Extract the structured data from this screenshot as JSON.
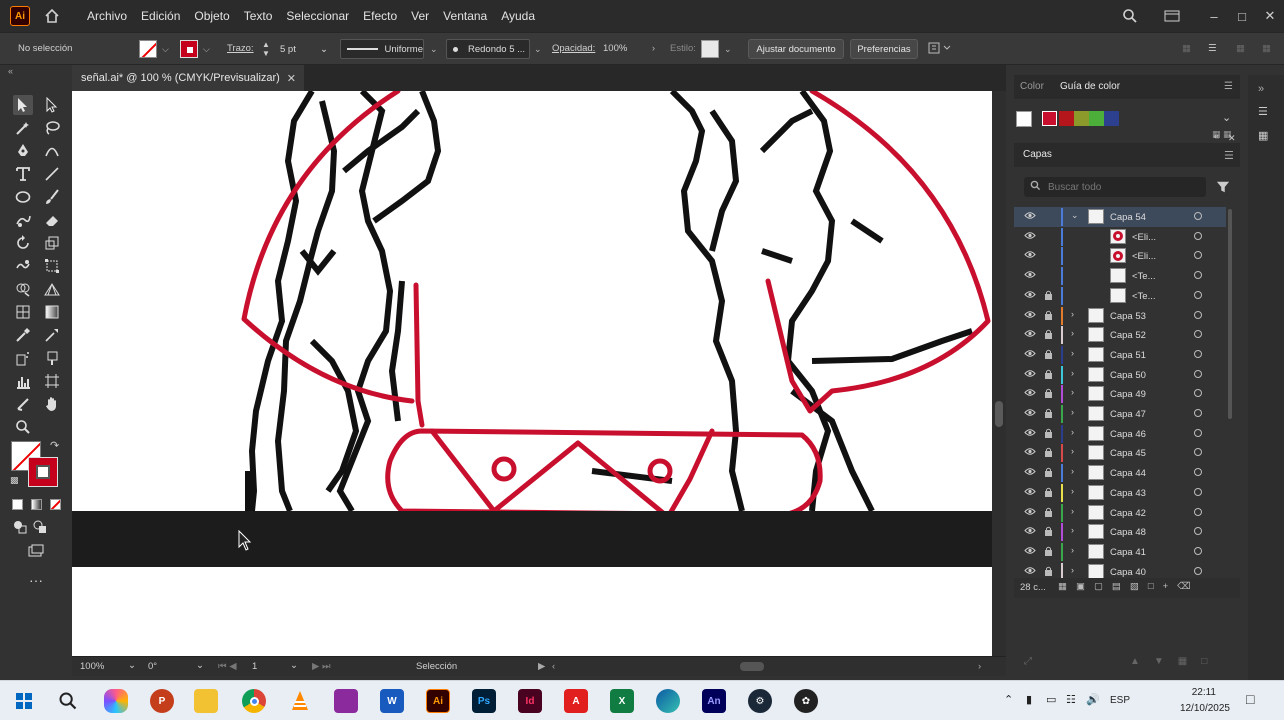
{
  "app": {
    "logo_text": "Ai",
    "menus": [
      "Archivo",
      "Edición",
      "Objeto",
      "Texto",
      "Seleccionar",
      "Efecto",
      "Ver",
      "Ventana",
      "Ayuda"
    ]
  },
  "control_bar": {
    "selection_label": "No selección",
    "stroke_label": "Trazo:",
    "stroke_value": "5 pt",
    "profile_value": "Uniforme",
    "brush_value": "Redondo 5 ...",
    "opacity_label": "Opacidad:",
    "opacity_value": "100%",
    "style_label": "Estilo:",
    "adjust_button": "Ajustar documento",
    "prefs_button": "Preferencias"
  },
  "document": {
    "tab_title": "señal.ai* @ 100 % (CMYK/Previsualizar)"
  },
  "status_bar": {
    "zoom": "100%",
    "rotation": "0°",
    "artboard": "1",
    "tool": "Selección"
  },
  "panels": {
    "tab_color": "Color",
    "tab_guide": "Guía de color",
    "layers_title": "Capas",
    "search_placeholder": "Buscar todo",
    "layers_count": "28 c...",
    "guide_colors": [
      "#ffffff",
      "#c8102e",
      "#b4161b",
      "#8c9a2b",
      "#4caf3a",
      "#2d3f8f"
    ]
  },
  "layers": [
    {
      "name": "Capa 54",
      "color": "#4a7bd8",
      "expanded": true,
      "selected": true,
      "lock": false
    },
    {
      "name": "<Eli...",
      "color": "#4a7bd8",
      "sub": true,
      "thumb": "circle-red"
    },
    {
      "name": "<Eli...",
      "color": "#4a7bd8",
      "sub": true,
      "thumb": "circle-red"
    },
    {
      "name": "<Te...",
      "color": "#4a7bd8",
      "sub": true,
      "thumb": "blank"
    },
    {
      "name": "<Te...",
      "color": "#4a7bd8",
      "sub": true,
      "thumb": "blank",
      "lock": true
    },
    {
      "name": "Capa 53",
      "color": "#e27b2b",
      "lock": true
    },
    {
      "name": "Capa 52",
      "color": "#d8ccd0",
      "lock": true
    },
    {
      "name": "Capa 51",
      "color": "#2a3d8f",
      "lock": true
    },
    {
      "name": "Capa 50",
      "color": "#3cc8d8",
      "lock": true
    },
    {
      "name": "Capa 49",
      "color": "#b24bd8",
      "lock": true
    },
    {
      "name": "Capa 47",
      "color": "#3aa84a",
      "lock": true
    },
    {
      "name": "Capa 46",
      "color": "#2a3d8f",
      "lock": true
    },
    {
      "name": "Capa 45",
      "color": "#d84a4a",
      "lock": true
    },
    {
      "name": "Capa 44",
      "color": "#4a7bd8",
      "lock": true
    },
    {
      "name": "Capa 43",
      "color": "#e8e04a",
      "lock": true
    },
    {
      "name": "Capa 42",
      "color": "#3aa84a",
      "lock": true
    },
    {
      "name": "Capa 48",
      "color": "#b24bd8",
      "lock": true
    },
    {
      "name": "Capa 41",
      "color": "#3aa84a",
      "lock": true
    },
    {
      "name": "Capa 40",
      "color": "#d8ccd0",
      "lock": true
    }
  ],
  "taskbar": {
    "icons": [
      "windows-start",
      "search",
      "copilot",
      "powerpoint",
      "file-explorer",
      "chrome",
      "vlc",
      "winrar",
      "word",
      "illustrator",
      "photoshop",
      "indesign",
      "acrobat",
      "excel",
      "edge",
      "animate",
      "steam",
      "davinci"
    ],
    "language": "ESP",
    "time": "22:11",
    "date": "12/10/2025"
  }
}
